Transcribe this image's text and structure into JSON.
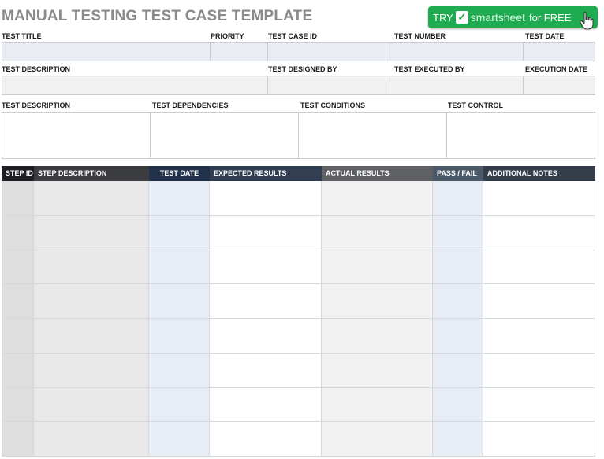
{
  "title": "MANUAL TESTING TEST CASE TEMPLATE",
  "cta": {
    "try": "TRY",
    "brand": "smartsheet",
    "suffix": "for FREE",
    "check": "✓"
  },
  "row1_labels": [
    "TEST TITLE",
    "PRIORITY",
    "TEST CASE ID",
    "TEST NUMBER",
    "TEST DATE"
  ],
  "row2_labels": [
    "TEST DESCRIPTION",
    "TEST DESIGNED BY",
    "TEST EXECUTED BY",
    "EXECUTION DATE"
  ],
  "row3_labels": [
    "TEST DESCRIPTION",
    "TEST DEPENDENCIES",
    "TEST CONDITIONS",
    "TEST CONTROL"
  ],
  "steps_table": {
    "headers": [
      "STEP ID",
      "STEP DESCRIPTION",
      "TEST DATE",
      "EXPECTED RESULTS",
      "ACTUAL RESULTS",
      "PASS / FAIL",
      "ADDITIONAL NOTES"
    ],
    "header_colors": [
      "#1f2024",
      "#3a3c40",
      "#22324a",
      "#323f52",
      "#5e6064",
      "#4b5868",
      "#343d4a"
    ],
    "cell_colors": [
      "#dedede",
      "#e9e9e9",
      "#e8ecf4",
      "#ffffff",
      "#f1f1f1",
      "#e8ecf4",
      "#ffffff"
    ],
    "row_count": 8
  },
  "icons": {
    "check": "checkmark-icon",
    "cursor": "hand-cursor-icon"
  }
}
